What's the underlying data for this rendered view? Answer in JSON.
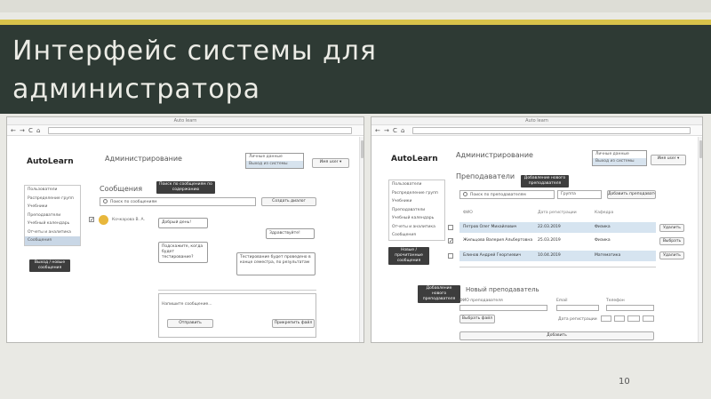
{
  "slide": {
    "title": "Интерфейс системы для администратора",
    "page_number": "10"
  },
  "left": {
    "browser_title": "Auto learn",
    "nav": {
      "back": "←",
      "forward": "→",
      "reload": "C",
      "home": "⌂"
    },
    "logo": "AutoLearn",
    "header": "Администрирование",
    "role_dropdown": {
      "items": [
        "Личные данные",
        "Выход из системы"
      ],
      "selected_index": 1
    },
    "user_button": "Имя user ▾",
    "menu": [
      "Пользователи",
      "Распределение групп",
      "Учебники",
      "Преподаватели",
      "Учебный календарь",
      "Отчеты и аналитика",
      "Сообщения"
    ],
    "menu_active_index": 6,
    "menu_tip": "Выход / новые сообщения",
    "messages": {
      "title": "Сообщения",
      "tip": "Поиск по сообщениям по содержанию",
      "search_placeholder": "Поиск по сообщениям",
      "new_dialog": "Создать диалог",
      "contact_name": "Кочкарова В. А.",
      "bubbles": [
        "Добрый день!",
        "Здравствуйте!",
        "Подскажите, когда будет тестирование?",
        "Тестирование будет проведено в конце семестра, по результатам"
      ],
      "compose_placeholder": "Напишите сообщение...",
      "send": "Отправить",
      "attach": "Прикрепить файл"
    }
  },
  "right": {
    "browser_title": "Auto learn",
    "nav": {
      "back": "←",
      "forward": "→",
      "reload": "C",
      "home": "⌂"
    },
    "logo": "AutoLearn",
    "header": "Администрирование",
    "role_dropdown": {
      "items": [
        "Личные данные",
        "Выход из системы"
      ],
      "selected_index": 1
    },
    "user_button": "Имя user ▾",
    "menu": [
      "Пользователи",
      "Распределение групп",
      "Учебники",
      "Преподаватели",
      "Учебный календарь",
      "Отчеты и аналитика",
      "Сообщения"
    ],
    "menu_tip": "Новые / прочитанные сообщения",
    "teachers": {
      "title": "Преподаватели",
      "tip": "Добавление нового преподавателя",
      "search_placeholder": "Поиск по преподавателям",
      "filter": "Группа",
      "add_button": "Добавить преподавателя",
      "columns": [
        "ФИО",
        "Дата регистрации",
        "Кафедра"
      ],
      "rows": [
        {
          "name": "Петров Олег Михайлович",
          "date": "22.03.2019",
          "dept": "Физика",
          "action": "Удалить",
          "checked": false
        },
        {
          "name": "Жильцова Валерия Альбертовна",
          "date": "25.03.2019",
          "dept": "Физика",
          "action": "Выбрать",
          "checked": true
        },
        {
          "name": "Блинов Андрей Георгиевич",
          "date": "10.04.2019",
          "dept": "Математика",
          "action": "Удалить",
          "checked": false
        }
      ]
    },
    "new_teacher": {
      "tip": "Добавление нового преподавателя",
      "title": "Новый преподаватель",
      "fio_label": "ФИО преподавателя",
      "email_label": "Email",
      "phone_label": "Телефон",
      "file_button": "Выбрать файл",
      "date_label": "Дата регистрации",
      "submit": "Добавить"
    }
  }
}
